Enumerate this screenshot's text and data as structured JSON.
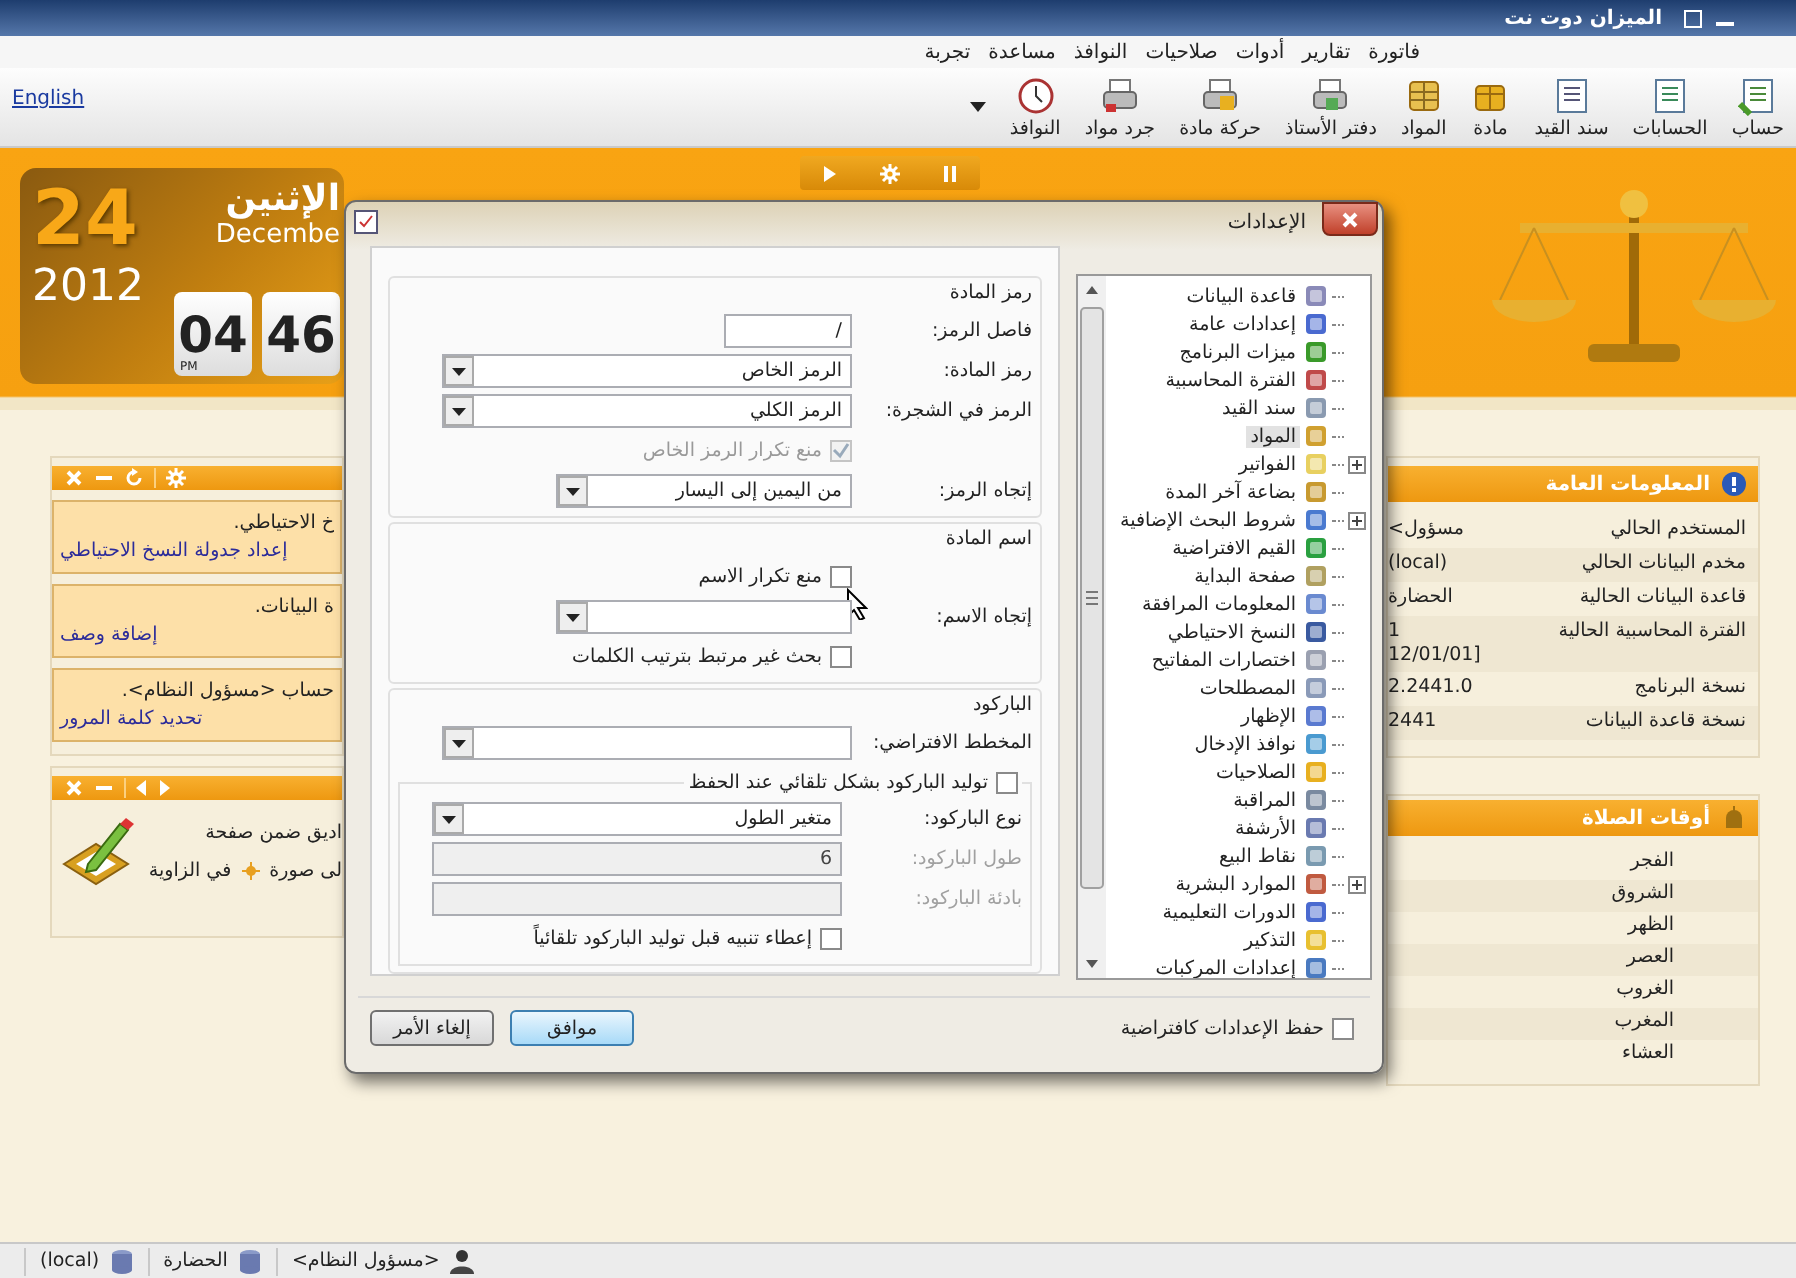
{
  "window": {
    "title": "الميزان دوت نت"
  },
  "menu": [
    "فاتورة",
    "تقارير",
    "أدوات",
    "صلاحيات",
    "النوافذ",
    "مساعدة",
    "تجربة"
  ],
  "toolbar": {
    "language_link": "English",
    "buttons": [
      "حساب",
      "الحسابات",
      "سند القيد",
      "مادة",
      "المواد",
      "دفتر الأستاذ",
      "حركة مادة",
      "جرد مواد",
      "النوافذ"
    ]
  },
  "date_card": {
    "day": "24",
    "year": "2012",
    "weekday": "الإثنين",
    "month": "Decembe",
    "hour": "04",
    "minute": "46",
    "meridiem": "PM"
  },
  "notices_panel": {
    "cards": [
      {
        "text": "خ الاحتياطي.",
        "link": "إعداد جدولة النسخ الاحتياطي"
      },
      {
        "text": "ة البيانات.",
        "link": "إضافة وصف"
      },
      {
        "text": "حساب <مسؤول النظام>.",
        "link": "تحديد كلمة المرور"
      }
    ]
  },
  "tips_panel": {
    "line_1": "اديق ضمن صفحة",
    "line_2_start": "لى صورة",
    "line_2_end": "في الزاوية"
  },
  "info_panel": {
    "title": "المعلومات العامة",
    "rows": [
      {
        "label": "المستخدم الحالي",
        "value": "<مسؤول"
      },
      {
        "label": "مخدم البيانات الحالي",
        "value": "(local)"
      },
      {
        "label": "قاعدة البيانات الحالية",
        "value": "الحضارة"
      },
      {
        "label": "الفترة المحاسبية الحالية",
        "value": "1\n12/01/01]"
      },
      {
        "label": "نسخة البرنامج",
        "value": "2.2441.0"
      },
      {
        "label": "نسخة قاعدة البيانات",
        "value": "2441"
      }
    ]
  },
  "prayer_panel": {
    "title": "أوقات الصلاة",
    "rows": [
      "الفجر",
      "الشروق",
      "الظهر",
      "العصر",
      "الغروب",
      "المغرب",
      "العشاء"
    ]
  },
  "dialog": {
    "title": "الإعدادات",
    "groups": [
      {
        "title": "رمز المادة",
        "rows": [
          {
            "kind": "text",
            "label": "فاصل الرمز:",
            "value": "/"
          },
          {
            "kind": "combo",
            "label": "رمز المادة:",
            "value": "الرمز الخاص"
          },
          {
            "kind": "combo",
            "label": "الرمز في الشجرة:",
            "value": "الرمز الكلي"
          },
          {
            "kind": "check",
            "label": "منع تكرار الرمز الخاص",
            "checked": true,
            "disabled": true
          },
          {
            "kind": "short_combo",
            "label": "إتجاه الرمز:",
            "value": "من اليمين إلى اليسار"
          }
        ]
      },
      {
        "title": "اسم المادة",
        "rows": [
          {
            "kind": "check",
            "label": "منع تكرار الاسم",
            "checked": false,
            "disabled": false
          },
          {
            "kind": "short_combo",
            "label": "إتجاه الاسم:"
          },
          {
            "kind": "check",
            "label": "بحث غير مرتبط بترتيب الكلمات",
            "checked": false,
            "disabled": false
          }
        ]
      },
      {
        "title": "الباركود",
        "rows": [
          {
            "kind": "combo",
            "label": "المخطط الافتراضي:"
          },
          {
            "kind": "subgroup",
            "check": {
              "label": "توليد الباركود بشكل تلقائي عند الحفظ",
              "checked": false
            },
            "rows": [
              {
                "kind": "combo",
                "label": "نوع الباركود:",
                "value": "متغير الطول"
              },
              {
                "kind": "field",
                "label": "طول الباركود:",
                "value": "6",
                "disabled": true
              },
              {
                "kind": "field",
                "label": "بادئة الباركود:",
                "disabled": true
              },
              {
                "kind": "check",
                "label": "إعطاء تنبيه قبل توليد الباركود تلقائياً",
                "checked": false,
                "disabled": false
              }
            ]
          }
        ]
      }
    ],
    "tree": [
      {
        "label": "قاعدة البيانات",
        "kind": "leaf",
        "selected": false
      },
      {
        "label": "إعدادات عامة",
        "kind": "leaf",
        "selected": false
      },
      {
        "label": "ميزات البرنامج",
        "kind": "leaf",
        "selected": false
      },
      {
        "label": "الفترة المحاسبية",
        "kind": "leaf",
        "selected": false
      },
      {
        "label": "سند القيد",
        "kind": "leaf",
        "selected": false
      },
      {
        "label": "المواد",
        "kind": "leaf",
        "selected": true
      },
      {
        "label": "الفواتير",
        "kind": "group",
        "selected": false
      },
      {
        "label": "بضاعة آخر المدة",
        "kind": "leaf",
        "selected": false
      },
      {
        "label": "شروط البحث الإضافية",
        "kind": "group",
        "selected": false
      },
      {
        "label": "القيم الافتراضية",
        "kind": "leaf",
        "selected": false
      },
      {
        "label": "صفحة البداية",
        "kind": "leaf",
        "selected": false
      },
      {
        "label": "المعلومات المرافقة",
        "kind": "leaf",
        "selected": false
      },
      {
        "label": "النسخ الاحتياطي",
        "kind": "leaf",
        "selected": false
      },
      {
        "label": "اختصارات المفاتيح",
        "kind": "leaf",
        "selected": false
      },
      {
        "label": "المصطلحات",
        "kind": "leaf",
        "selected": false
      },
      {
        "label": "الإظهار",
        "kind": "leaf",
        "selected": false
      },
      {
        "label": "نوافذ الإدخال",
        "kind": "leaf",
        "selected": false
      },
      {
        "label": "الصلاحيات",
        "kind": "leaf",
        "selected": false
      },
      {
        "label": "المراقبة",
        "kind": "leaf",
        "selected": false
      },
      {
        "label": "الأرشفة",
        "kind": "leaf",
        "selected": false
      },
      {
        "label": "نقاط البيع",
        "kind": "leaf",
        "selected": false
      },
      {
        "label": "الموارد البشرية",
        "kind": "group",
        "selected": false
      },
      {
        "label": "الدورات التعليمية",
        "kind": "leaf",
        "selected": false
      },
      {
        "label": "التذكير",
        "kind": "leaf",
        "selected": false
      },
      {
        "label": "إعدادات المركبات",
        "kind": "leaf",
        "selected": false
      }
    ],
    "save_default": {
      "label": "حفظ الإعدادات كافتراضية",
      "checked": false
    },
    "buttons": [
      {
        "label": "موافق",
        "default": true
      },
      {
        "label": "إلغاء الأمر",
        "default": false
      }
    ]
  },
  "status_bar": [
    {
      "kind": "user",
      "text": "<مسؤول النظام>"
    },
    {
      "kind": "database",
      "text": "الحضارة"
    },
    {
      "kind": "database",
      "text": "(local)"
    }
  ]
}
